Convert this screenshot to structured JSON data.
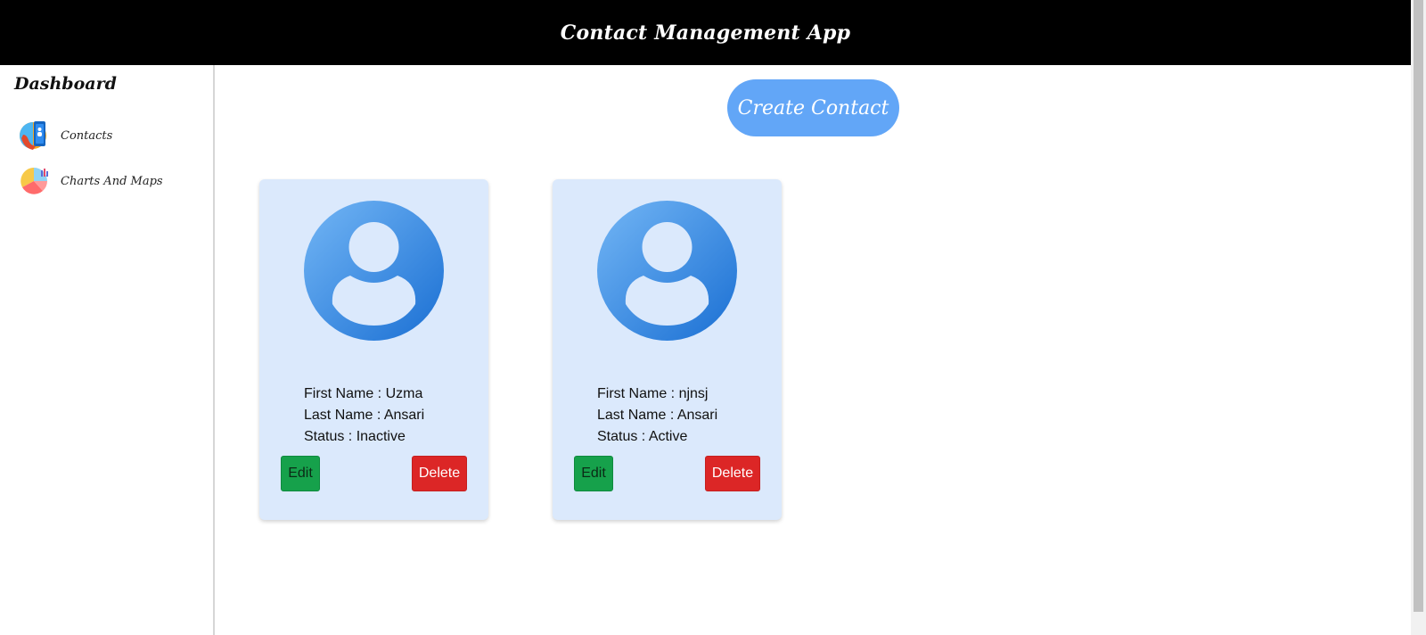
{
  "header": {
    "title": "Contact Management App"
  },
  "sidebar": {
    "title": "Dashboard",
    "items": [
      {
        "label": "Contacts",
        "icon": "contacts-icon"
      },
      {
        "label": "Charts And Maps",
        "icon": "charts-icon"
      }
    ]
  },
  "main": {
    "create_label": "Create Contact",
    "contacts": [
      {
        "first_name": "First Name : Uzma",
        "last_name": "Last Name : Ansari",
        "status": "Status : Inactive",
        "edit_label": "Edit",
        "delete_label": "Delete"
      },
      {
        "first_name": "First Name : njnsj",
        "last_name": "Last Name : Ansari",
        "status": "Status : Active",
        "edit_label": "Edit",
        "delete_label": "Delete"
      }
    ]
  },
  "colors": {
    "header_bg": "#000000",
    "create_button": "#62a6f7",
    "card_bg": "#dbe9fc",
    "edit_button": "#16a14b",
    "delete_button": "#dc2626"
  }
}
